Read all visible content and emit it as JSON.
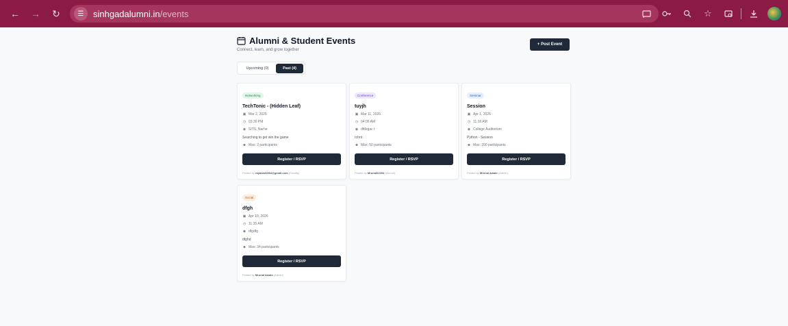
{
  "browser": {
    "url_host": "sinhgadalumni.in",
    "url_path": "/events"
  },
  "header": {
    "title": "Alumni & Student Events",
    "subtitle": "Connect, learn, and grow together",
    "post_button": "+  Post Event"
  },
  "tabs": {
    "upcoming": "Upcoming (0)",
    "past": "Past (4)"
  },
  "register_label": "Register / RSVP",
  "posted_prefix": "Posted by",
  "events": [
    {
      "category": "Networking",
      "title": "TechTonic - (Hidden Leaf)",
      "date": "Mar 2, 2025",
      "time": "03:30 PM",
      "location": "SITS, Narhe",
      "description": "Searching to get win the game",
      "participants": "Max: 2 participants",
      "posted_by": "rayavad1984@gmail.com",
      "role": "(Faculty)"
    },
    {
      "category": "Conference",
      "title": "tuyjh",
      "date": "Mar 11, 2026",
      "time": "04:06 AM",
      "location": "dfdsgac t",
      "description": "rchnt",
      "participants": "Max: 50 participants",
      "posted_by": "Mrunal02004",
      "role": "(Alumni)"
    },
    {
      "category": "Seminar",
      "title": "Session",
      "date": "Apr 1, 2026",
      "time": "11:18 AM",
      "location": "College Auditorium",
      "description": "Python - Session",
      "participants": "Max: 200 participants",
      "posted_by": "Mrunal Awate",
      "role": "(Admin)"
    },
    {
      "category": "Social",
      "title": "dfgh",
      "date": "Apr 10, 2026",
      "time": "11:35 AM",
      "location": "dfgdfg",
      "description": "dfghd",
      "participants": "Max: 34 participants",
      "posted_by": "Mrunal Awate",
      "role": "(Admin)"
    }
  ]
}
